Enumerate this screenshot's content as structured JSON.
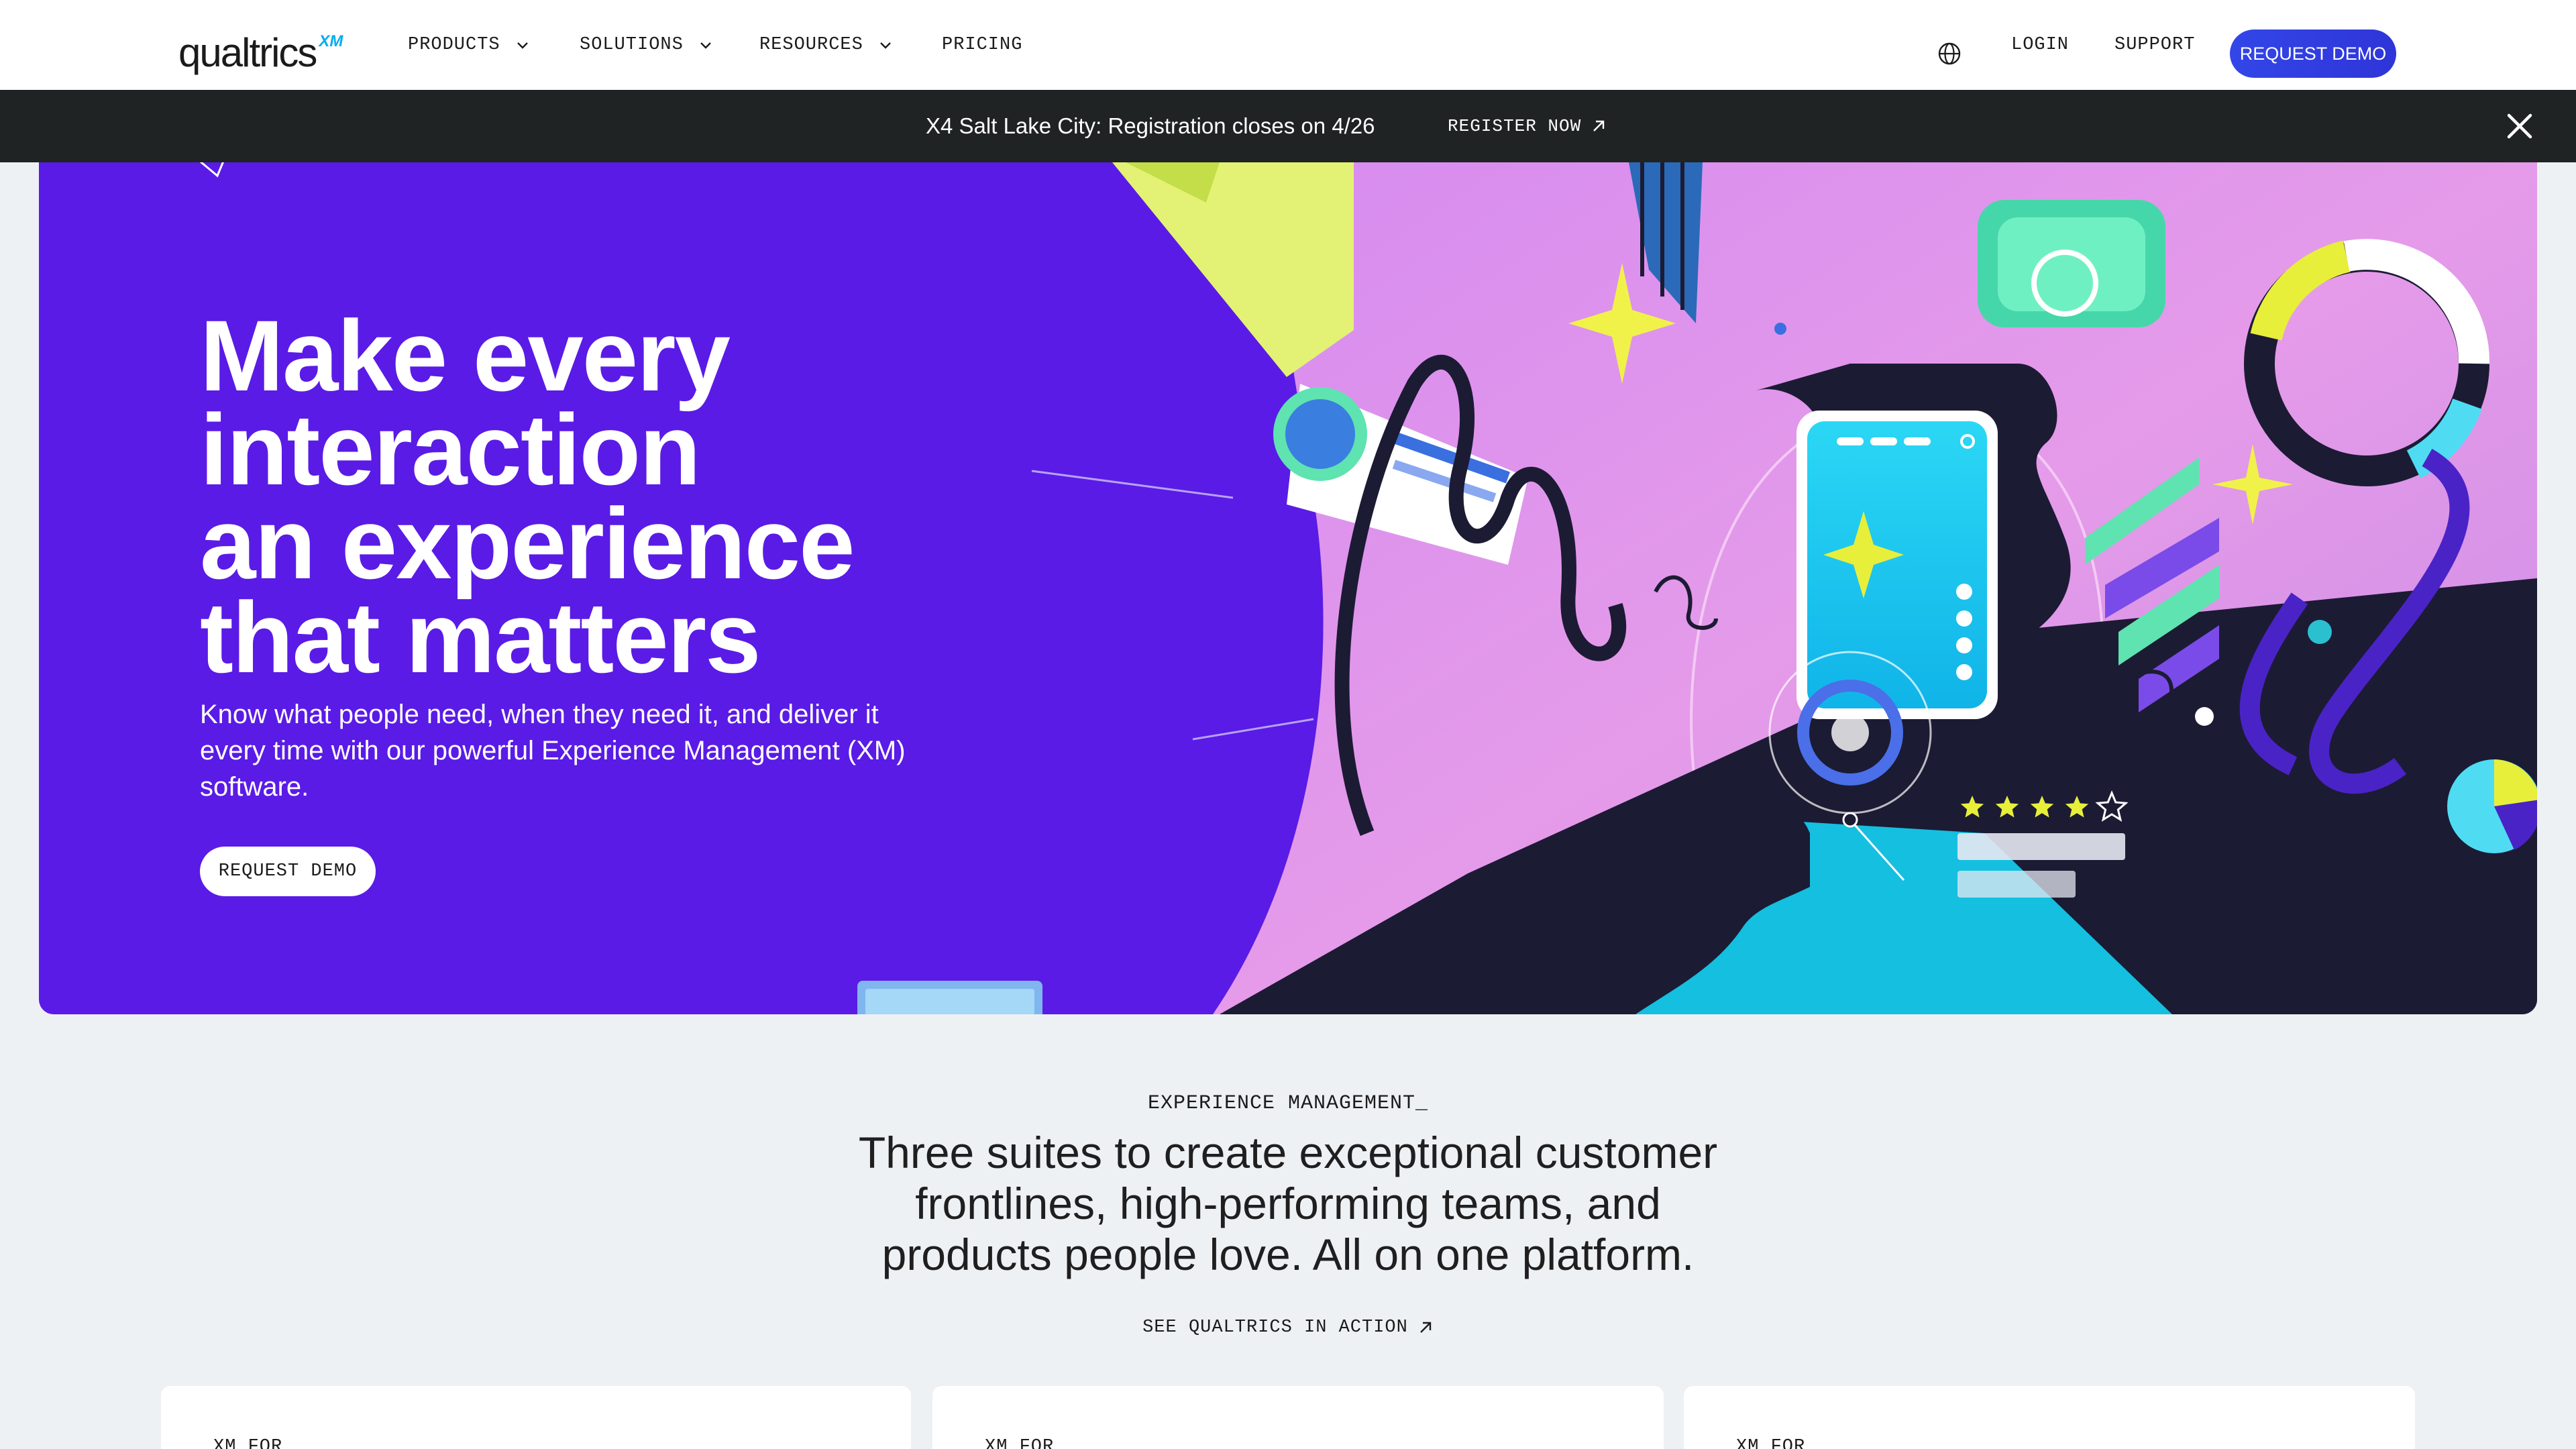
{
  "nav": {
    "logo_text": "qualtrics",
    "logo_superscript": "XM",
    "items": [
      {
        "label": "PRODUCTS",
        "has_dropdown": true
      },
      {
        "label": "SOLUTIONS",
        "has_dropdown": true
      },
      {
        "label": "RESOURCES",
        "has_dropdown": true
      },
      {
        "label": "PRICING",
        "has_dropdown": false
      }
    ],
    "language_icon": "globe-icon",
    "login_label": "LOGIN",
    "support_label": "SUPPORT",
    "request_demo_label": "REQUEST DEMO"
  },
  "announcement": {
    "text": "X4 Salt Lake City: Registration closes on 4/26",
    "link_label": "REGISTER NOW",
    "link_icon": "arrow-up-right-icon",
    "close_icon": "close-icon"
  },
  "hero": {
    "title_lines": [
      "Make every",
      "interaction",
      "an experience",
      "that matters"
    ],
    "subtitle": "Know what people need, when they need it, and deliver it every time with our powerful Experience Management (XM) software.",
    "button_label": "REQUEST DEMO",
    "rating_stars": 4,
    "rating_max": 5
  },
  "experience": {
    "eyebrow": "EXPERIENCE MANAGEMENT_",
    "heading": "Three suites to create exceptional customer frontlines, high-performing teams, and products people love. All on one platform.",
    "link_label": "SEE QUALTRICS IN ACTION",
    "cards": [
      {
        "label": "XM FOR"
      },
      {
        "label": "XM FOR"
      },
      {
        "label": "XM FOR"
      }
    ]
  },
  "colors": {
    "hero_purple": "#5a1be6",
    "button_blue": "#3346e8",
    "announcement_bg": "#202324",
    "page_bg": "#eef1f4",
    "accent_cyan": "#00aeef"
  }
}
